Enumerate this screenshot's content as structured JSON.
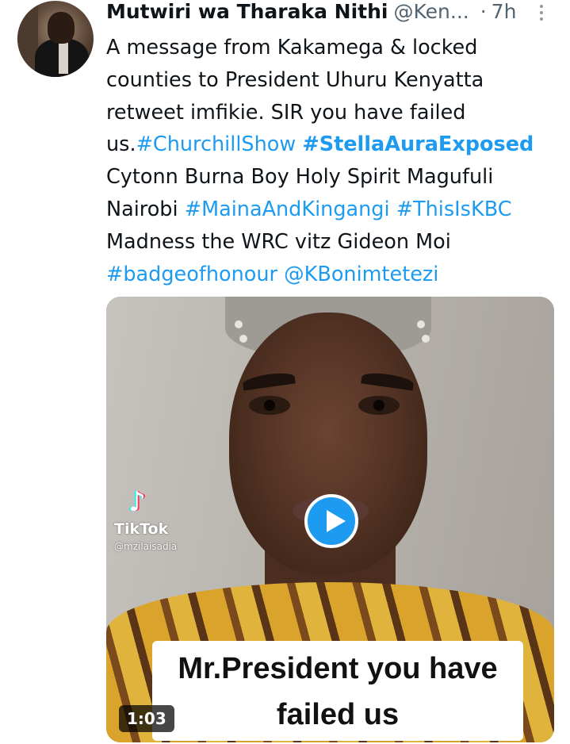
{
  "tweet": {
    "author_name": "Mutwiri wa Tharaka Nithi",
    "author_handle": "@Ken...",
    "separator": "·",
    "time": "7h",
    "lines": [
      [
        {
          "t": "A message from Kakamega & locked"
        }
      ],
      [
        {
          "t": "counties to President Uhuru Kenyatta"
        }
      ],
      [
        {
          "t": "retweet imfikie. SIR you have failed"
        }
      ],
      [
        {
          "t": "us."
        },
        {
          "t": "#ChurchillShow",
          "link": true
        },
        {
          "t": " "
        },
        {
          "t": "#StellaAuraExposed",
          "link": true,
          "bold": true
        }
      ],
      [
        {
          "t": "Cytonn Burna Boy Holy Spirit Magufuli"
        }
      ],
      [
        {
          "t": "Nairobi "
        },
        {
          "t": "#MainaAndKingangi",
          "link": true
        },
        {
          "t": " "
        },
        {
          "t": "#ThisIsKBC",
          "link": true
        }
      ],
      [
        {
          "t": "Madness the WRC vitz Gideon Moi"
        }
      ],
      [
        {
          "t": "#badgeofhonour",
          "link": true
        },
        {
          "t": " "
        },
        {
          "t": "@KBonimtetezi",
          "link": true
        }
      ]
    ]
  },
  "video": {
    "watermark_brand": "TikTok",
    "watermark_user": "@mzilaisadia",
    "caption_line1": "Mr.President you have",
    "caption_line2": "failed us",
    "duration": "1:03"
  },
  "colors": {
    "link": "#1d9bf0",
    "text": "#0f1419",
    "muted": "#536471",
    "play_button": "#1d9bf0"
  },
  "icons": {
    "more": "vertical-ellipsis-icon",
    "play": "play-icon",
    "tiktok": "tiktok-logo-icon"
  }
}
